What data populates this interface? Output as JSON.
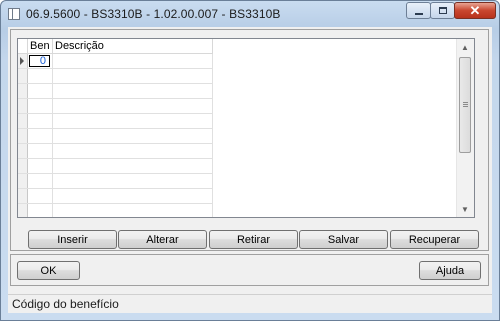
{
  "window": {
    "title": "06.9.5600 - BS3310B - 1.02.00.007 - BS3310B",
    "close_glyph": "✕"
  },
  "grid": {
    "columns": [
      {
        "label": "Ben"
      },
      {
        "label": "Descrição"
      }
    ],
    "rows": [
      {
        "ben": "0",
        "descricao": ""
      }
    ]
  },
  "actions": {
    "inserir": "Inserir",
    "alterar": "Alterar",
    "retirar": "Retirar",
    "salvar": "Salvar",
    "recuperar": "Recuperar"
  },
  "footer": {
    "ok": "OK",
    "ajuda": "Ajuda"
  },
  "status": {
    "text": "Código do benefício"
  },
  "icons": {
    "scroll_up": "▲",
    "scroll_down": "▼"
  }
}
